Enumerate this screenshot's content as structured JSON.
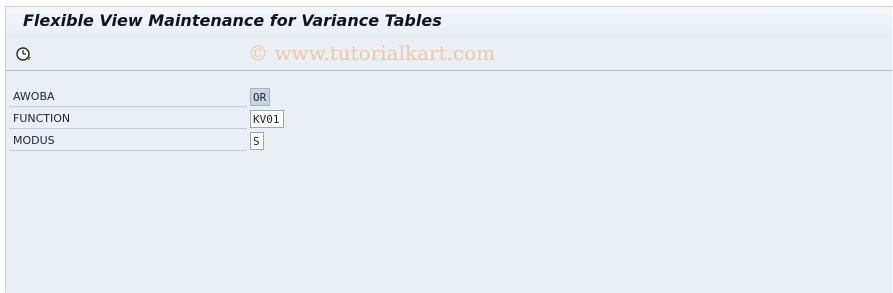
{
  "window": {
    "title": "Flexible View Maintenance for Variance Tables"
  },
  "toolbar": {
    "execute_icon": "clock-execute-icon",
    "watermark": "© www.tutorialkart.com"
  },
  "fields": [
    {
      "label": "AWOBA",
      "value": "OR",
      "editable": false
    },
    {
      "label": "FUNCTION",
      "value": "KV01",
      "editable": true
    },
    {
      "label": "MODUS",
      "value": "S",
      "editable": true
    }
  ]
}
